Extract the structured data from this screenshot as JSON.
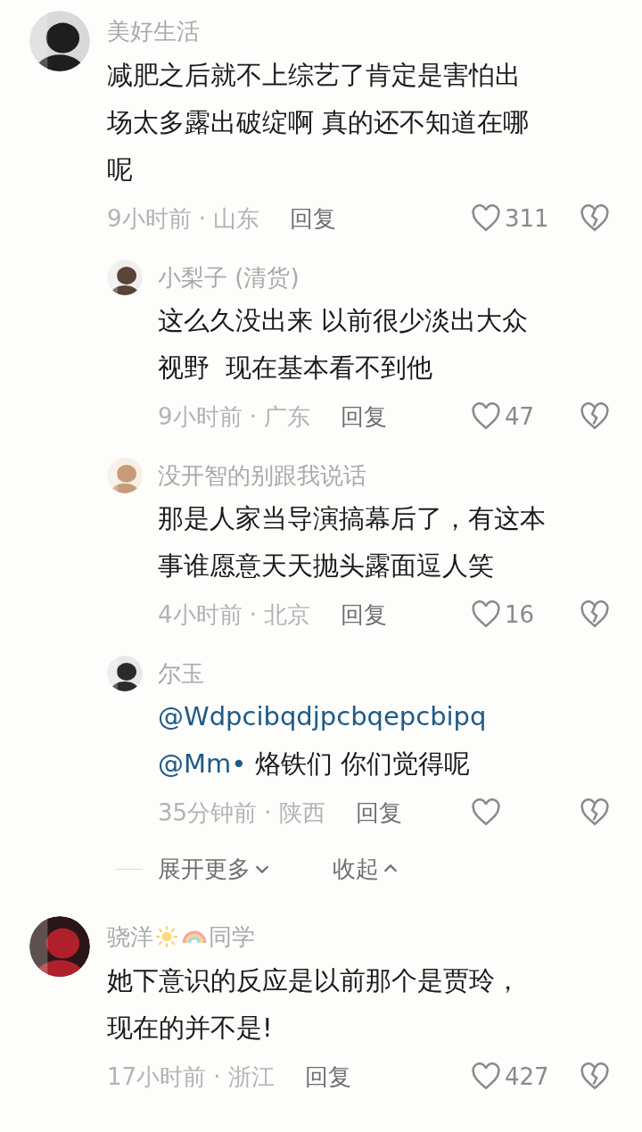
{
  "comments": [
    {
      "name": [
        {
          "kind": "text",
          "text": "美好生活"
        }
      ],
      "body": [
        {
          "kind": "text",
          "text": "减肥之后就不上综艺了肯定是害怕出"
        },
        {
          "kind": "break"
        },
        {
          "kind": "text",
          "text": "场太多露出破绽啊 真的还不知道在哪"
        },
        {
          "kind": "break"
        },
        {
          "kind": "text",
          "text": "呢"
        }
      ],
      "meta": "9小时前 · 山东",
      "reply": "回复",
      "likes": "311",
      "children": [
        {
          "name": [
            {
              "kind": "text",
              "text": "小梨子 (清货)"
            }
          ],
          "body": [
            {
              "kind": "text",
              "text": "这么久没出来 以前很少淡出大众"
            },
            {
              "kind": "break"
            },
            {
              "kind": "text",
              "text": "视野  现在基本看不到他"
            }
          ],
          "meta": "9小时前 · 广东",
          "reply": "回复",
          "likes": "47"
        },
        {
          "name": [
            {
              "kind": "text",
              "text": "没开智的别跟我说话"
            }
          ],
          "body": [
            {
              "kind": "text",
              "text": "那是人家当导演搞幕后了，有这本"
            },
            {
              "kind": "break"
            },
            {
              "kind": "text",
              "text": "事谁愿意天天抛头露面逗人笑"
            }
          ],
          "meta": "4小时前 · 北京",
          "reply": "回复",
          "likes": "16"
        },
        {
          "name": [
            {
              "kind": "text",
              "text": "尔玉"
            }
          ],
          "body": [
            {
              "kind": "mention",
              "text": "@Wdpcibqdjpcbqepcbipq"
            },
            {
              "kind": "break"
            },
            {
              "kind": "mention",
              "text": "@Mm•"
            },
            {
              "kind": "text",
              "text": " 烙铁们 你们觉得呢"
            }
          ],
          "meta": "35分钟前 · 陕西",
          "reply": "回复"
        }
      ],
      "more": {
        "expand": "展开更多",
        "collapse": "收起"
      }
    },
    {
      "name": [
        {
          "kind": "text",
          "text": "骁洋"
        },
        {
          "kind": "sun"
        },
        {
          "kind": "rainbow"
        },
        {
          "kind": "text",
          "text": "同学"
        }
      ],
      "body": [
        {
          "kind": "text",
          "text": "她下意识的反应是以前那个是贾玲，"
        },
        {
          "kind": "break"
        },
        {
          "kind": "text",
          "text": "现在的并不是!"
        }
      ],
      "meta": "17小时前 · 浙江",
      "reply": "回复",
      "likes": "427"
    }
  ]
}
